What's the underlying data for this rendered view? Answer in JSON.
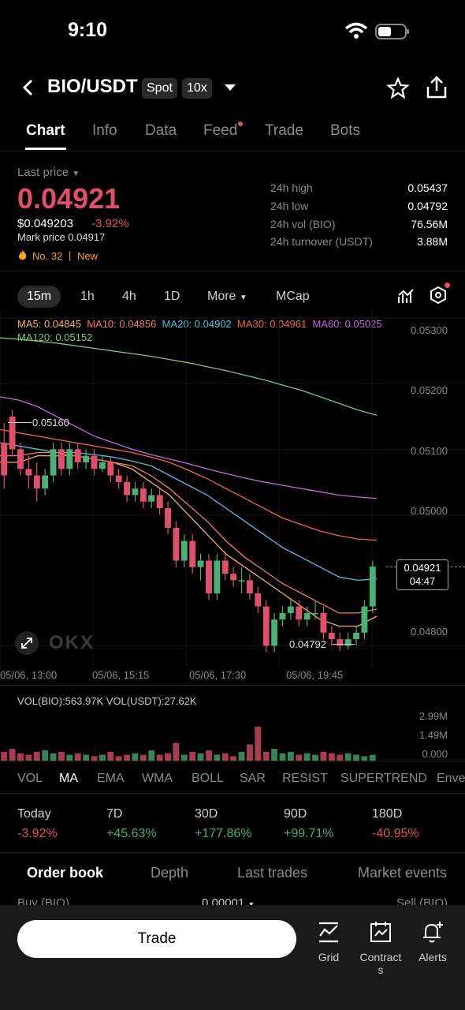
{
  "status": {
    "time": "9:10"
  },
  "header": {
    "pair": "BIO/USDT",
    "market_type": "Spot",
    "leverage": "10x"
  },
  "tabs": [
    {
      "label": "Chart",
      "active": true
    },
    {
      "label": "Info"
    },
    {
      "label": "Data"
    },
    {
      "label": "Feed"
    },
    {
      "label": "Trade"
    },
    {
      "label": "Bots"
    }
  ],
  "price": {
    "last_price_label": "Last price",
    "last_price": "0.04921",
    "usd_price": "$0.049203",
    "change": "-3.92%",
    "mark_price": "Mark price 0.04917",
    "rank": "No. 32",
    "separator": "|",
    "tag": "New"
  },
  "stats": [
    {
      "label": "24h high",
      "value": "0.05437"
    },
    {
      "label": "24h low",
      "value": "0.04792"
    },
    {
      "label": "24h vol (BIO)",
      "value": "76.56M"
    },
    {
      "label": "24h turnover (USDT)",
      "value": "3.88M"
    }
  ],
  "timeframes": [
    {
      "label": "15m",
      "active": true
    },
    {
      "label": "1h"
    },
    {
      "label": "4h"
    },
    {
      "label": "1D"
    },
    {
      "label": "More"
    },
    {
      "label": "MCap"
    }
  ],
  "ma_legend": {
    "ma5": "MA5: 0.04845",
    "ma10": "MA10: 0.04856",
    "ma20": "MA20: 0.04902",
    "ma30": "MA30: 0.04961",
    "ma60": "MA60: 0.05025",
    "ma120": "MA120: 0.05152"
  },
  "colors": {
    "up": "#4caf73",
    "down": "#e0506b",
    "ma5": "#f2b84b",
    "ma10": "#f07c6b",
    "ma20": "#4fc3dc",
    "ma30": "#f0654a",
    "ma60": "#c46ae0",
    "ma120": "#7cc87a"
  },
  "chart_data": {
    "type": "candlestick",
    "y_ticks": [
      "0.05300",
      "0.05200",
      "0.05100",
      "0.05000",
      "0.04800"
    ],
    "ylim": [
      0.0478,
      0.0531
    ],
    "x_ticks": [
      "05/06, 13:00",
      "05/06, 15:15",
      "05/06, 17:30",
      "05/06, 19:45"
    ],
    "high_marker": "0.05160",
    "low_marker": "0.04792",
    "current_price": "0.04921",
    "countdown": "04:47",
    "watermark": "OKX",
    "candles": [
      [
        0.0511,
        0.0506,
        0.0514,
        0.0504
      ],
      [
        0.0515,
        0.051,
        0.0516,
        0.0509
      ],
      [
        0.051,
        0.0507,
        0.0511,
        0.0506
      ],
      [
        0.0507,
        0.0506,
        0.0509,
        0.0504
      ],
      [
        0.0506,
        0.0504,
        0.0508,
        0.0502
      ],
      [
        0.0504,
        0.0506,
        0.0507,
        0.0503
      ],
      [
        0.0506,
        0.051,
        0.0511,
        0.0505
      ],
      [
        0.051,
        0.0507,
        0.0511,
        0.0506
      ],
      [
        0.0507,
        0.051,
        0.0511,
        0.0506
      ],
      [
        0.051,
        0.0508,
        0.0511,
        0.0507
      ],
      [
        0.0508,
        0.0509,
        0.051,
        0.0507
      ],
      [
        0.0509,
        0.0507,
        0.051,
        0.0506
      ],
      [
        0.0507,
        0.0508,
        0.0509,
        0.05065
      ],
      [
        0.0508,
        0.0506,
        0.0509,
        0.0505
      ],
      [
        0.0506,
        0.0505,
        0.0507,
        0.0504
      ],
      [
        0.0505,
        0.0503,
        0.0506,
        0.0502
      ],
      [
        0.0503,
        0.0504,
        0.0505,
        0.0502
      ],
      [
        0.0504,
        0.0502,
        0.0505,
        0.0501
      ],
      [
        0.0502,
        0.0503,
        0.0504,
        0.0501
      ],
      [
        0.0503,
        0.0501,
        0.0504,
        0.05
      ],
      [
        0.0501,
        0.0498,
        0.0502,
        0.0497
      ],
      [
        0.0498,
        0.0493,
        0.0499,
        0.0492
      ],
      [
        0.0493,
        0.0496,
        0.0497,
        0.0492
      ],
      [
        0.0496,
        0.0492,
        0.0497,
        0.0491
      ],
      [
        0.0492,
        0.0493,
        0.0494,
        0.049
      ],
      [
        0.0493,
        0.0488,
        0.0494,
        0.0487
      ],
      [
        0.0488,
        0.0493,
        0.0494,
        0.0487
      ],
      [
        0.0493,
        0.0491,
        0.0494,
        0.049
      ],
      [
        0.0491,
        0.049,
        0.0492,
        0.0489
      ],
      [
        0.049,
        0.049,
        0.0492,
        0.0488
      ],
      [
        0.049,
        0.0488,
        0.0491,
        0.0487
      ],
      [
        0.0488,
        0.0486,
        0.0489,
        0.0485
      ],
      [
        0.0486,
        0.048,
        0.0487,
        0.0479
      ],
      [
        0.048,
        0.0484,
        0.0485,
        0.0479
      ],
      [
        0.0484,
        0.0485,
        0.0486,
        0.0483
      ],
      [
        0.0485,
        0.0486,
        0.0487,
        0.0484
      ],
      [
        0.0486,
        0.0484,
        0.0487,
        0.0483
      ],
      [
        0.0484,
        0.0485,
        0.0486,
        0.0483
      ],
      [
        0.0485,
        0.0485,
        0.0487,
        0.0484
      ],
      [
        0.0485,
        0.0482,
        0.0486,
        0.0481
      ],
      [
        0.0482,
        0.0481,
        0.0483,
        0.048
      ],
      [
        0.0481,
        0.048,
        0.0482,
        0.04792
      ],
      [
        0.048,
        0.0481,
        0.0482,
        0.04795
      ],
      [
        0.0481,
        0.0482,
        0.0483,
        0.048
      ],
      [
        0.0482,
        0.0486,
        0.0487,
        0.0481
      ],
      [
        0.0486,
        0.04921,
        0.0493,
        0.0485
      ]
    ],
    "ma_series": {
      "ma5": [
        0.0508,
        0.0508,
        0.0509,
        0.0509,
        0.0509,
        0.05085,
        0.0508,
        0.0507,
        0.0505,
        0.0503,
        0.05,
        0.0497,
        0.0494,
        0.0492,
        0.049,
        0.0488,
        0.0486,
        0.0484,
        0.0483,
        0.0483,
        0.04845
      ],
      "ma10": [
        0.0509,
        0.0509,
        0.05095,
        0.05095,
        0.0509,
        0.05085,
        0.0508,
        0.05075,
        0.0506,
        0.0504,
        0.05015,
        0.0499,
        0.0496,
        0.04935,
        0.04915,
        0.04895,
        0.0488,
        0.04865,
        0.0485,
        0.0485,
        0.04856
      ],
      "ma20": [
        0.0511,
        0.05105,
        0.051,
        0.05095,
        0.05095,
        0.05092,
        0.05088,
        0.05082,
        0.05075,
        0.0506,
        0.05045,
        0.0503,
        0.0501,
        0.0499,
        0.0497,
        0.0495,
        0.04935,
        0.0492,
        0.04905,
        0.049,
        0.04902
      ],
      "ma30": [
        0.0513,
        0.05125,
        0.0512,
        0.05115,
        0.0511,
        0.05105,
        0.051,
        0.05095,
        0.05088,
        0.0508,
        0.05068,
        0.05055,
        0.0504,
        0.05025,
        0.0501,
        0.04995,
        0.04985,
        0.04975,
        0.04968,
        0.04963,
        0.04961
      ],
      "ma60": [
        0.0518,
        0.05175,
        0.05165,
        0.0515,
        0.05135,
        0.0512,
        0.0511,
        0.051,
        0.05092,
        0.05085,
        0.05078,
        0.0507,
        0.05063,
        0.05056,
        0.0505,
        0.05045,
        0.0504,
        0.05035,
        0.0503,
        0.05027,
        0.05025
      ],
      "ma120": [
        0.0527,
        0.05268,
        0.05265,
        0.05262,
        0.05258,
        0.05254,
        0.0525,
        0.05246,
        0.05242,
        0.05237,
        0.05232,
        0.05226,
        0.0522,
        0.05213,
        0.05206,
        0.05198,
        0.0519,
        0.0518,
        0.0517,
        0.0516,
        0.05152
      ]
    }
  },
  "volume": {
    "legend": "VOL(BIO):563.97K VOL(USDT):27.62K",
    "ticks": [
      "2.99M",
      "1.49M",
      "0.000"
    ],
    "max": 2.99,
    "values": [
      0.6,
      0.8,
      0.5,
      0.4,
      0.6,
      0.7,
      0.5,
      0.6,
      0.4,
      0.5,
      0.4,
      0.3,
      0.4,
      0.6,
      0.3,
      0.4,
      0.5,
      0.4,
      0.7,
      0.4,
      0.5,
      1.2,
      0.4,
      0.6,
      0.5,
      0.7,
      0.4,
      0.5,
      0.3,
      0.6,
      1.1,
      2.3,
      0.6,
      0.8,
      0.5,
      0.6,
      0.4,
      0.5,
      0.4,
      0.6,
      0.5,
      0.4,
      0.5,
      0.4,
      0.3,
      0.4
    ]
  },
  "indicators": [
    "VOL",
    "MA",
    "EMA",
    "WMA",
    "BOLL",
    "SAR",
    "RESIST",
    "SUPERTREND",
    "Enve"
  ],
  "active_indicator": "MA",
  "performance": [
    {
      "label": "Today",
      "value": "-3.92%",
      "dir": "down"
    },
    {
      "label": "7D",
      "value": "+45.63%",
      "dir": "up"
    },
    {
      "label": "30D",
      "value": "+177.86%",
      "dir": "up"
    },
    {
      "label": "90D",
      "value": "+99.71%",
      "dir": "up"
    },
    {
      "label": "180D",
      "value": "-40.95%",
      "dir": "down"
    }
  ],
  "order_tabs": [
    "Order book",
    "Depth",
    "Last trades",
    "Market events"
  ],
  "order_book": {
    "buy": "Buy (BIO)",
    "precision": "0.00001",
    "sell": "Sell (BIO)"
  },
  "bottom": {
    "trade": "Trade",
    "grid": "Grid",
    "contracts_1": "Contract",
    "contracts_2": "s",
    "alerts": "Alerts"
  }
}
